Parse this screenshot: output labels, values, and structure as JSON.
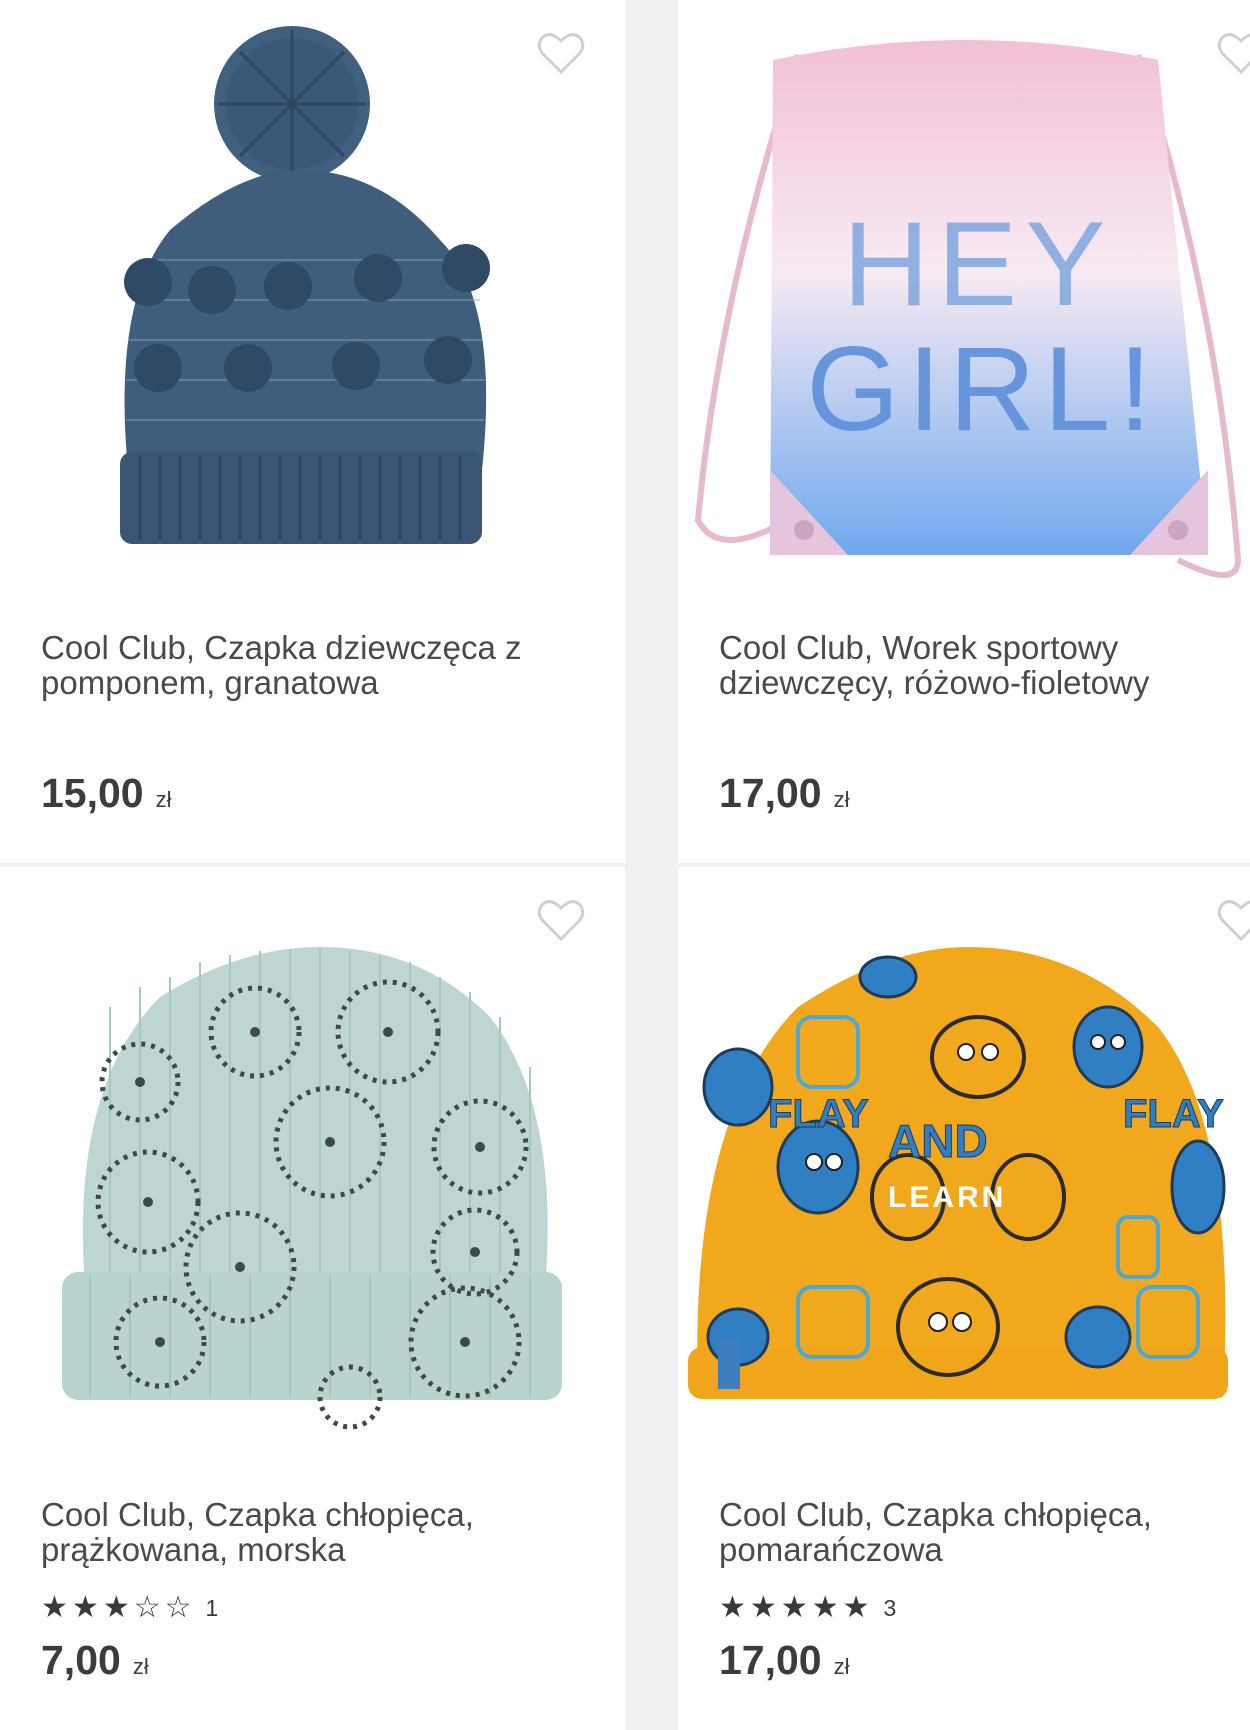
{
  "products": [
    {
      "title": "Cool Club, Czapka dziewczęca z pomponem, granatowa",
      "price": "15,00",
      "currency": "zł",
      "image_icon": "navy-pompom-beanie-image",
      "wishlist_icon": "heart-outline-icon"
    },
    {
      "title": "Cool Club, Worek sportowy dziewczęcy, różowo-fioletowy",
      "price": "17,00",
      "currency": "zł",
      "image_icon": "drawstring-bag-image",
      "bag_print": [
        "HEY",
        "GIRL!"
      ],
      "wishlist_icon": "heart-outline-icon"
    },
    {
      "title": "Cool Club, Czapka chłopięca, prążkowana, morska",
      "rating": 3,
      "rating_max": 5,
      "rating_count": "1",
      "price": "7,00",
      "currency": "zł",
      "image_icon": "mint-hedgehog-beanie-image",
      "wishlist_icon": "heart-outline-icon"
    },
    {
      "title": "Cool Club, Czapka chłopięca, pomarańczowa",
      "rating": 5,
      "rating_max": 5,
      "rating_count": "3",
      "price": "17,00",
      "currency": "zł",
      "image_icon": "orange-monster-beanie-image",
      "hat_print": [
        "FLAY",
        "AND",
        "LEARN",
        "FLAY"
      ],
      "wishlist_icon": "heart-outline-icon"
    }
  ],
  "colors": {
    "page_bg": "#f0f0f0",
    "card_bg": "#ffffff",
    "text": "#4a4a4a",
    "heart_stroke": "#d0d0d0",
    "navy_hat": "#3d5a78",
    "mint_hat": "#bcd5d2",
    "orange_hat": "#f2a81d"
  }
}
